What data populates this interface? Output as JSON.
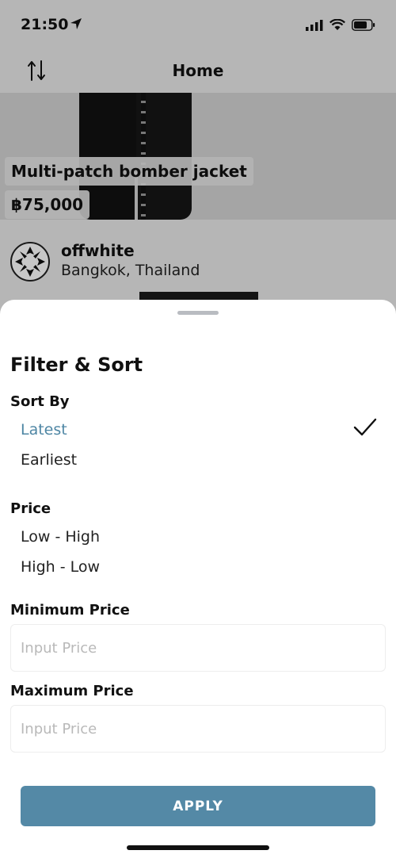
{
  "status_bar": {
    "time": "21:50"
  },
  "nav": {
    "title": "Home"
  },
  "product": {
    "name": "Multi-patch bomber jacket",
    "price": "฿75,000"
  },
  "seller": {
    "name": "offwhite",
    "location": "Bangkok, Thailand"
  },
  "sheet": {
    "title": "Filter & Sort",
    "sort_by": {
      "label": "Sort By",
      "options": [
        {
          "label": "Latest",
          "selected": true
        },
        {
          "label": "Earliest",
          "selected": false
        }
      ]
    },
    "price": {
      "label": "Price",
      "options": [
        {
          "label": "Low - High"
        },
        {
          "label": "High - Low"
        }
      ]
    },
    "min_price": {
      "label": "Minimum Price",
      "placeholder": "Input Price",
      "value": ""
    },
    "max_price": {
      "label": "Maximum Price",
      "placeholder": "Input Price",
      "value": ""
    },
    "apply_label": "APPLY"
  },
  "colors": {
    "accent": "#5489a6",
    "selected_text": "#4e86a4"
  }
}
